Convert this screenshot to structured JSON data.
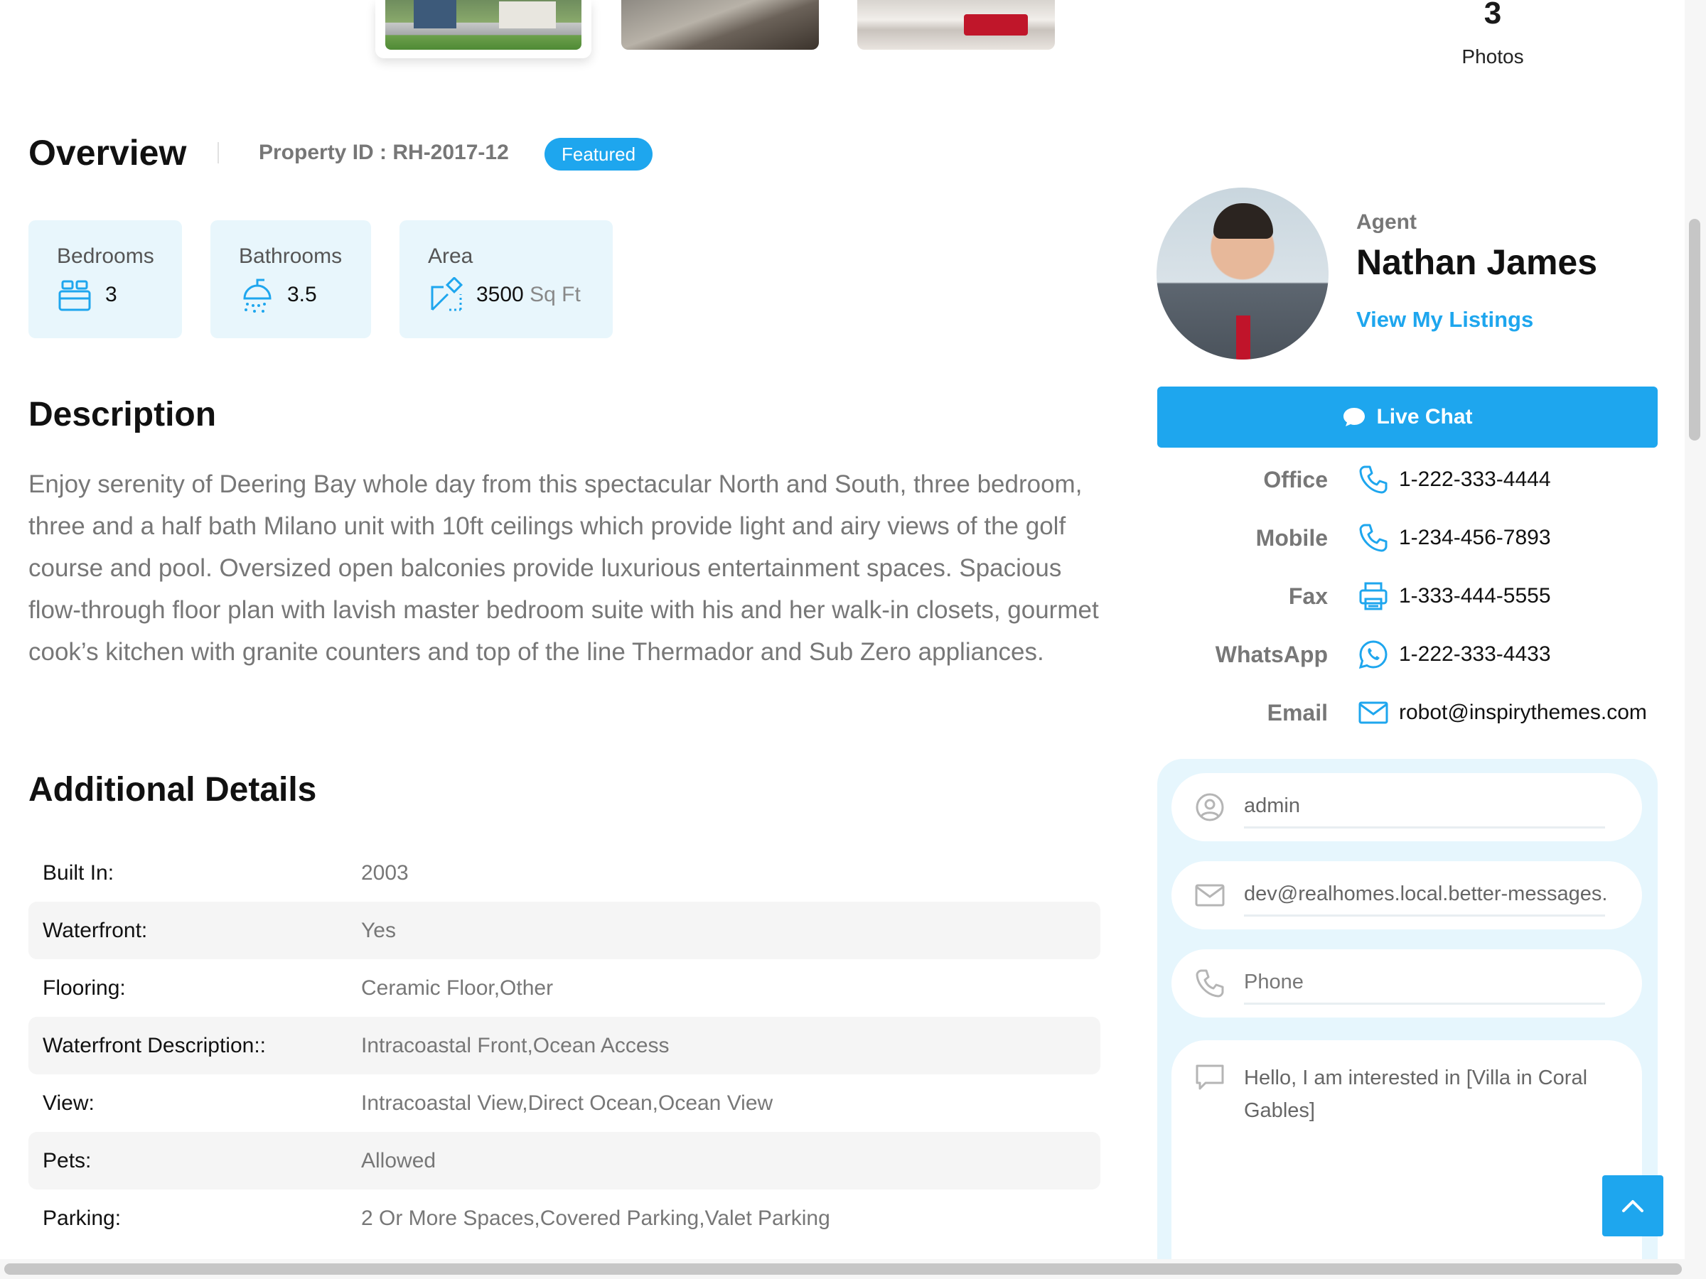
{
  "gallery": {
    "photo_count": "3",
    "photos_label": "Photos"
  },
  "overview": {
    "title": "Overview",
    "property_id": "Property ID : RH-2017-12",
    "badge": "Featured",
    "features": [
      {
        "label": "Bedrooms",
        "value": "3",
        "icon": "bed-icon"
      },
      {
        "label": "Bathrooms",
        "value": "3.5",
        "icon": "shower-icon"
      },
      {
        "label": "Area",
        "value": "3500",
        "unit": "Sq Ft",
        "icon": "area-icon"
      }
    ]
  },
  "description": {
    "title": "Description",
    "text": "Enjoy serenity of Deering Bay whole day from this spectacular North and South, three bedroom, three and a half bath Milano unit with 10ft ceilings which provide light and airy views of the golf course and pool. Oversized open balconies provide luxurious entertainment spaces. Spacious flow-through floor plan with lavish master bedroom suite with his and her walk-in closets, gourmet cook’s kitchen with granite counters and top of the line Thermador and Sub Zero appliances."
  },
  "additional": {
    "title": "Additional Details",
    "rows": [
      {
        "key": "Built In:",
        "value": "2003"
      },
      {
        "key": "Waterfront:",
        "value": "Yes"
      },
      {
        "key": "Flooring:",
        "value": "Ceramic Floor,Other"
      },
      {
        "key": "Waterfront Description::",
        "value": "Intracoastal Front,Ocean Access"
      },
      {
        "key": "View:",
        "value": "Intracoastal View,Direct Ocean,Ocean View"
      },
      {
        "key": "Pets:",
        "value": "Allowed"
      },
      {
        "key": "Parking:",
        "value": "2 Or More Spaces,Covered Parking,Valet Parking"
      }
    ]
  },
  "agent": {
    "label": "Agent",
    "name": "Nathan James",
    "listings_link": "View My Listings",
    "chat_button": "Live Chat",
    "contacts": [
      {
        "label": "Office",
        "value": "1-222-333-4444",
        "icon": "phone-icon"
      },
      {
        "label": "Mobile",
        "value": "1-234-456-7893",
        "icon": "phone-icon"
      },
      {
        "label": "Fax",
        "value": "1-333-444-5555",
        "icon": "printer-icon"
      },
      {
        "label": "WhatsApp",
        "value": "1-222-333-4433",
        "icon": "whatsapp-icon"
      },
      {
        "label": "Email",
        "value": "robot@inspirythemes.com",
        "icon": "mail-icon"
      }
    ]
  },
  "form": {
    "name_value": "admin",
    "email_value": "dev@realhomes.local.better-messages.c",
    "phone_placeholder": "Phone",
    "message_value": "Hello, I am interested in [Villa in Coral Gables]"
  },
  "colors": {
    "accent": "#1ea6ee",
    "feature_bg": "#e8f6fc",
    "form_bg": "#e6f6fd"
  }
}
